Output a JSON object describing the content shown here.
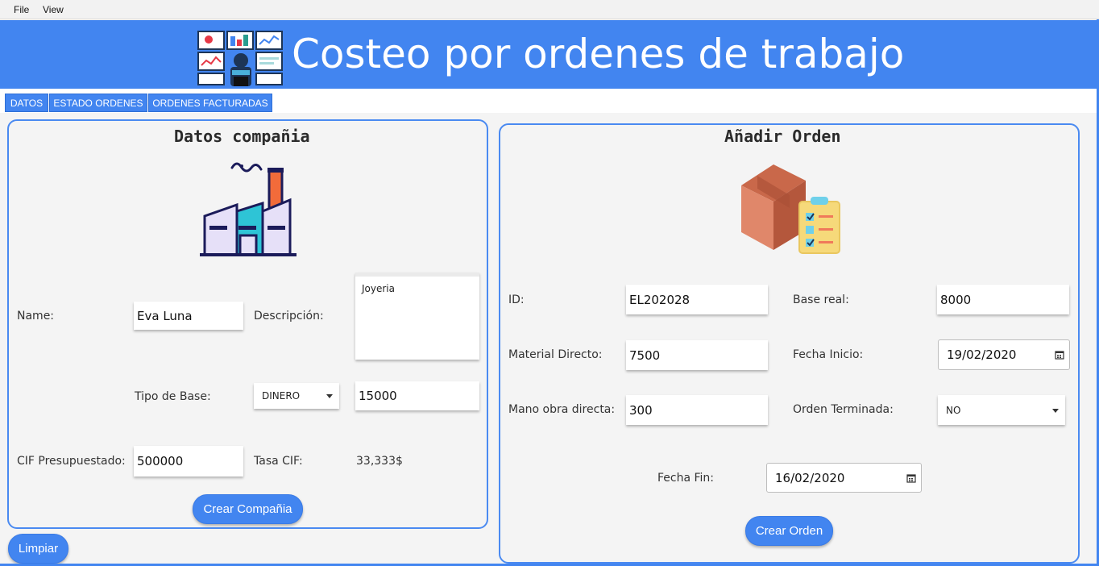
{
  "menu": {
    "file": "File",
    "view": "View"
  },
  "header": {
    "title": "Costeo por ordenes de trabajo",
    "logo_icon": "monitoring-workstation-icon"
  },
  "tabs": [
    {
      "label": "DATOS"
    },
    {
      "label": "ESTADO ORDENES"
    },
    {
      "label": "ORDENES FACTURADAS"
    }
  ],
  "company": {
    "title": "Datos compañia",
    "illustration": "factory-icon",
    "name_label": "Name:",
    "name_value": "Eva Luna",
    "description_label": "Descripción:",
    "description_value": "Joyeria",
    "base_type_label": "Tipo de Base:",
    "base_type_value": "DINERO",
    "base_value": "15000",
    "cif_label": "CIF Presupuestado:",
    "cif_value": "500000",
    "rate_label": "Tasa CIF:",
    "rate_value": "33,333$",
    "create_button": "Crear Compañia"
  },
  "clear_button": "Limpiar",
  "order": {
    "title": "Añadir Orden",
    "illustration": "box-checklist-icon",
    "id_label": "ID:",
    "id_value": "EL202028",
    "real_base_label": "Base real:",
    "real_base_value": "8000",
    "direct_material_label": "Material Directo:",
    "direct_material_value": "7500",
    "start_date_label": "Fecha Inicio:",
    "start_date_value": "19/02/2020",
    "direct_labor_label": "Mano obra directa:",
    "direct_labor_value": "300",
    "finished_label": "Orden Terminada:",
    "finished_value": "NO",
    "end_date_label": "Fecha Fin:",
    "end_date_value": "16/02/2020",
    "create_button": "Crear Orden"
  },
  "colors": {
    "accent": "#4285f0",
    "panel_border": "#4a8af1"
  }
}
